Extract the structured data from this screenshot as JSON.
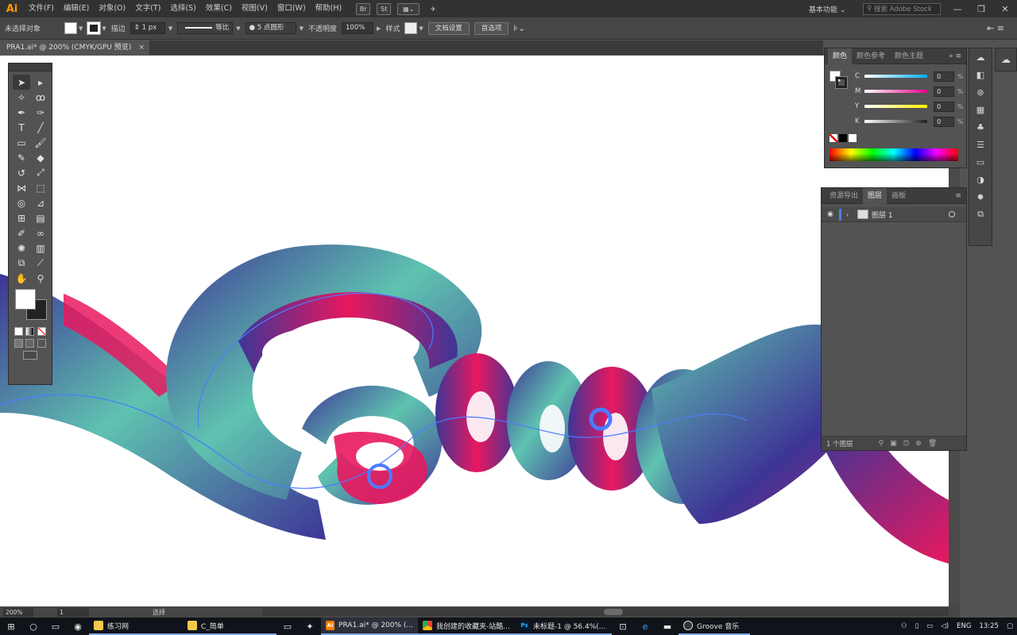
{
  "app": {
    "logo": "Ai",
    "menu": [
      "文件(F)",
      "编辑(E)",
      "对象(O)",
      "文字(T)",
      "选择(S)",
      "效果(C)",
      "视图(V)",
      "窗口(W)",
      "帮助(H)"
    ],
    "bridge_label": "Br",
    "stock_label": "St",
    "workspace": "基本功能 ⌄",
    "stock_search_placeholder": "搜索 Adobe Stock",
    "window_controls": [
      "—",
      "❐",
      "✕"
    ]
  },
  "control_bar": {
    "selection_label": "未选择对象",
    "stroke_label": "描边",
    "stroke_weight": "1 px",
    "stroke_style": "等比",
    "brush": "5 点圆形",
    "opacity_label": "不透明度",
    "opacity_value": "100%",
    "style_label": "样式",
    "doc_setup_button": "文档设置",
    "preferences_button": "首选项"
  },
  "document_tab": {
    "title": "PRA1.ai* @ 200% (CMYK/GPU 预览)",
    "close": "×"
  },
  "color_panel": {
    "tabs": [
      "颜色",
      "颜色参考",
      "颜色主题"
    ],
    "active_tab": 0,
    "channels": [
      {
        "label": "C",
        "value": "0",
        "color_start": "#ffffff",
        "color_end": "#00aeef"
      },
      {
        "label": "M",
        "value": "0",
        "color_start": "#ffffff",
        "color_end": "#ec008c"
      },
      {
        "label": "Y",
        "value": "0",
        "color_start": "#ffffff",
        "color_end": "#fff200"
      },
      {
        "label": "K",
        "value": "0",
        "color_start": "#ffffff",
        "color_end": "#231f20"
      }
    ],
    "unit": "%"
  },
  "layers_panel": {
    "tabs": [
      "资源导出",
      "图层",
      "画板"
    ],
    "active_tab": 1,
    "layer_name": "图层 1",
    "layer_count": "1 个图层"
  },
  "status_bar": {
    "zoom": "200%",
    "page": "1",
    "tool": "选择"
  },
  "taskbar": {
    "apps": [
      {
        "label": "练习网",
        "icon_color": "#f2c94c"
      },
      {
        "label": "C_简单",
        "icon_color": "#f2c94c"
      },
      {
        "label": "PRA1.ai* @ 200% (...",
        "icon_color": "#ff7c00",
        "icon_text": "Ai"
      },
      {
        "label": "我创建的收藏夹-站酷...",
        "icon_color": "#4caf50"
      },
      {
        "label": "未标题-1 @ 56.4%(...",
        "icon_color": "#31a8ff",
        "icon_text": "Ps"
      },
      {
        "label": "Groove 音乐",
        "icon_color": "#555"
      }
    ],
    "language": "ENG",
    "time": "13:25"
  },
  "colors": {
    "ribbon_teal": "#5fc3b0",
    "ribbon_purple": "#3d3596",
    "ribbon_magenta": "#e8185f",
    "ribbon_blue_line": "#4a7cff"
  }
}
